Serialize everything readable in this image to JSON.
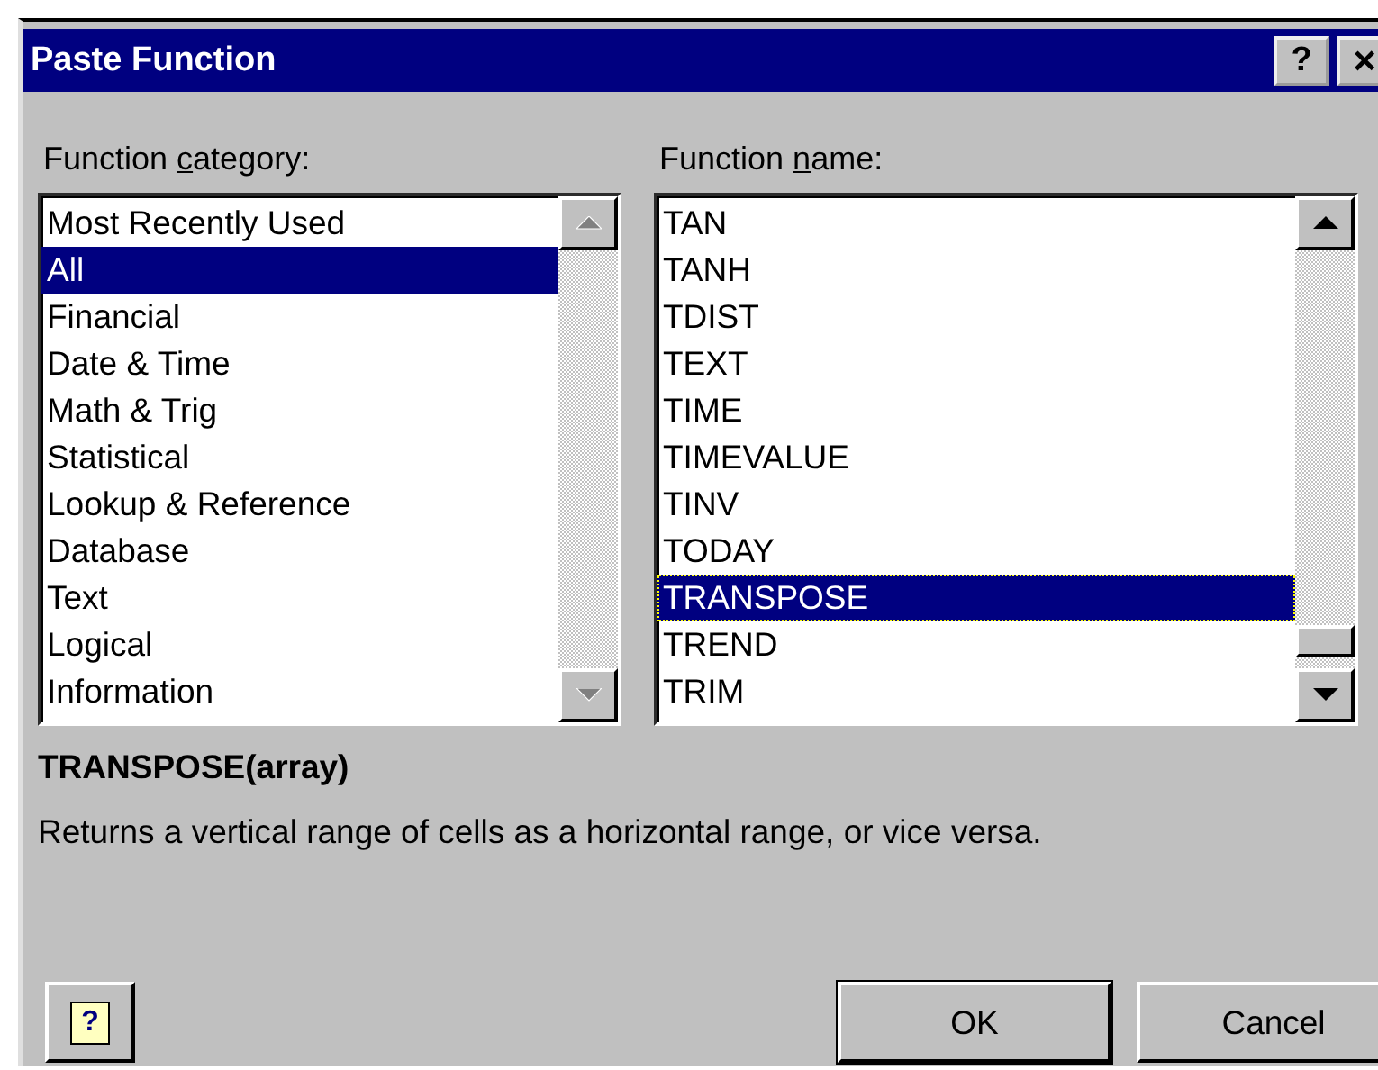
{
  "window": {
    "title": "Paste Function",
    "title_buttons": [
      {
        "kind": "help",
        "glyph": "?"
      },
      {
        "kind": "close",
        "glyph": "×"
      }
    ]
  },
  "category_list": {
    "label_parts": [
      {
        "text": "Function ",
        "underlined": false
      },
      {
        "text": "c",
        "underlined": true
      },
      {
        "text": "ategory:",
        "underlined": false
      }
    ],
    "focused": false,
    "scroll_disabled": true,
    "items": [
      {
        "label": "Most Recently Used",
        "selected": false
      },
      {
        "label": "All",
        "selected": true
      },
      {
        "label": "Financial",
        "selected": false
      },
      {
        "label": "Date & Time",
        "selected": false
      },
      {
        "label": "Math & Trig",
        "selected": false
      },
      {
        "label": "Statistical",
        "selected": false
      },
      {
        "label": "Lookup & Reference",
        "selected": false
      },
      {
        "label": "Database",
        "selected": false
      },
      {
        "label": "Text",
        "selected": false
      },
      {
        "label": "Logical",
        "selected": false
      },
      {
        "label": "Information",
        "selected": false
      }
    ]
  },
  "function_list": {
    "label_parts": [
      {
        "text": "Function ",
        "underlined": false
      },
      {
        "text": "n",
        "underlined": true
      },
      {
        "text": "ame:",
        "underlined": false
      }
    ],
    "focused": true,
    "scroll_disabled": false,
    "items": [
      {
        "label": "TAN",
        "selected": false
      },
      {
        "label": "TANH",
        "selected": false
      },
      {
        "label": "TDIST",
        "selected": false
      },
      {
        "label": "TEXT",
        "selected": false
      },
      {
        "label": "TIME",
        "selected": false
      },
      {
        "label": "TIMEVALUE",
        "selected": false
      },
      {
        "label": "TINV",
        "selected": false
      },
      {
        "label": "TODAY",
        "selected": false
      },
      {
        "label": "TRANSPOSE",
        "selected": true
      },
      {
        "label": "TREND",
        "selected": false
      },
      {
        "label": "TRIM",
        "selected": false
      }
    ]
  },
  "syntax": "TRANSPOSE(array)",
  "description": "Returns a vertical range of cells as a horizontal range, or vice versa.",
  "help_button": {
    "glyph": "?"
  },
  "buttons": [
    {
      "label": "OK"
    },
    {
      "label": "Cancel"
    }
  ]
}
